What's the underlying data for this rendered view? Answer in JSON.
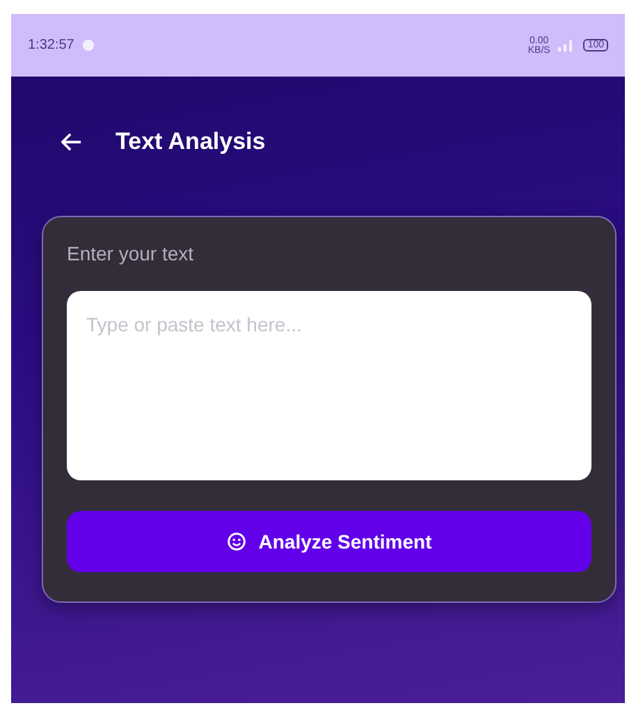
{
  "status_bar": {
    "time": "1:32:57",
    "speed": "0.00",
    "speed_unit": "KB/S",
    "battery": "100"
  },
  "app_bar": {
    "title": "Text Analysis"
  },
  "card": {
    "label": "Enter your text",
    "input": {
      "placeholder": "Type or paste text here..."
    },
    "button": {
      "label": "Analyze Sentiment"
    }
  }
}
